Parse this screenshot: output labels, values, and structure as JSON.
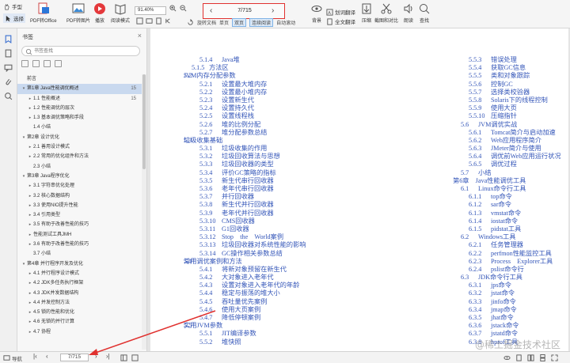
{
  "toolbar": {
    "hand_label": "手型",
    "select_label": "选择",
    "pdf_to_office_label": "PDF转Office",
    "pdf_to_image_label": "PDF转图片",
    "play_label": "播放",
    "read_mode_label": "阅读模式",
    "zoom_value": "91.40%",
    "page_value": "7/715",
    "rotate_label": "旋转文档",
    "single_page_label": "单页",
    "double_page_label": "双页",
    "continuous_read_label": "连续阅读",
    "auto_scroll_label": "自动滚动",
    "background_label": "背景",
    "translate_label": "划词翻译",
    "full_translate_label": "全文翻译",
    "compress_label": "压缩",
    "crop_label": "截图和对比",
    "read_aloud_label": "朗读",
    "find_label": "查找"
  },
  "sidebar": {
    "title": "书签",
    "search_placeholder": "书签查找",
    "items": [
      {
        "text": "前言",
        "toggle": "",
        "indent": 0,
        "page": "",
        "selected": false
      },
      {
        "text": "第1章 Java性能调优概述",
        "toggle": "▾",
        "indent": 0,
        "page": "15",
        "selected": true
      },
      {
        "text": "1.1 性能概述",
        "toggle": "▸",
        "indent": 1,
        "page": "15",
        "selected": false
      },
      {
        "text": "1.2 性能调优的层次",
        "toggle": "▸",
        "indent": 1,
        "page": "",
        "selected": false
      },
      {
        "text": "1.3 基本调优策略和手段",
        "toggle": "▸",
        "indent": 1,
        "page": "",
        "selected": false
      },
      {
        "text": "1.4 小结",
        "toggle": "",
        "indent": 1,
        "page": "",
        "selected": false
      },
      {
        "text": "第2章 设计优化",
        "toggle": "▾",
        "indent": 0,
        "page": "",
        "selected": false
      },
      {
        "text": "2.1 善用设计模式",
        "toggle": "▸",
        "indent": 1,
        "page": "",
        "selected": false
      },
      {
        "text": "2.2 常用的优化组件和方法",
        "toggle": "▸",
        "indent": 1,
        "page": "",
        "selected": false
      },
      {
        "text": "2.3 小结",
        "toggle": "",
        "indent": 1,
        "page": "",
        "selected": false
      },
      {
        "text": "第3章 Java程序优化",
        "toggle": "▾",
        "indent": 0,
        "page": "",
        "selected": false
      },
      {
        "text": "3.1 字符串优化处理",
        "toggle": "▸",
        "indent": 1,
        "page": "",
        "selected": false
      },
      {
        "text": "3.2 核心数据结构",
        "toggle": "▸",
        "indent": 1,
        "page": "",
        "selected": false
      },
      {
        "text": "3.3 使用NIO提升性能",
        "toggle": "▸",
        "indent": 1,
        "page": "",
        "selected": false
      },
      {
        "text": "3.4 引用类型",
        "toggle": "▸",
        "indent": 1,
        "page": "",
        "selected": false
      },
      {
        "text": "3.5 有助于改善性能的技巧",
        "toggle": "▸",
        "indent": 1,
        "page": "",
        "selected": false
      },
      {
        "text": "性能测试工具JMH",
        "toggle": "▸",
        "indent": 1,
        "page": "",
        "selected": false
      },
      {
        "text": "3.6 有助于改善性能的技巧",
        "toggle": "▸",
        "indent": 1,
        "page": "",
        "selected": false
      },
      {
        "text": "3.7 小结",
        "toggle": "",
        "indent": 1,
        "page": "",
        "selected": false
      },
      {
        "text": "第4章 并行程序开发及优化",
        "toggle": "▾",
        "indent": 0,
        "page": "",
        "selected": false
      },
      {
        "text": "4.1 并行程序设计模式",
        "toggle": "▸",
        "indent": 1,
        "page": "",
        "selected": false
      },
      {
        "text": "4.2 JDK多任务执行框架",
        "toggle": "▸",
        "indent": 1,
        "page": "",
        "selected": false
      },
      {
        "text": "4.3 JDK并发数据结构",
        "toggle": "▸",
        "indent": 1,
        "page": "",
        "selected": false
      },
      {
        "text": "4.4 并发控制方法",
        "toggle": "▸",
        "indent": 1,
        "page": "",
        "selected": false
      },
      {
        "text": "4.5 锁的性能和优化",
        "toggle": "▸",
        "indent": 1,
        "page": "",
        "selected": false
      },
      {
        "text": "4.6 无锁的并行计算",
        "toggle": "▸",
        "indent": 1,
        "page": "",
        "selected": false
      },
      {
        "text": "4.7 协程",
        "toggle": "▸",
        "indent": 1,
        "page": "",
        "selected": false
      }
    ]
  },
  "toc": {
    "left": [
      {
        "num": "5.1.4",
        "text": "Java堆",
        "level": 3
      },
      {
        "num": "5.1.5",
        "text": "方法区",
        "level": 2
      },
      {
        "num": "5.2",
        "text": "JVM内存分配参数",
        "level": 1
      },
      {
        "num": "5.2.1",
        "text": "设置最大堆内存",
        "level": 3
      },
      {
        "num": "5.2.2",
        "text": "设置最小堆内存",
        "level": 3
      },
      {
        "num": "5.2.3",
        "text": "设置新生代",
        "level": 3
      },
      {
        "num": "5.2.4",
        "text": "设置持久代",
        "level": 3
      },
      {
        "num": "5.2.5",
        "text": "设置线程栈",
        "level": 3
      },
      {
        "num": "5.2.6",
        "text": "堆的比例分配",
        "level": 3
      },
      {
        "num": "5.2.7",
        "text": "堆分配参数总结",
        "level": 3
      },
      {
        "num": "5.3",
        "text": "垃圾收集基础",
        "level": 1
      },
      {
        "num": "5.3.1",
        "text": "垃圾收集的作用",
        "level": 3
      },
      {
        "num": "5.3.2",
        "text": "垃圾回收算法与思想",
        "level": 3
      },
      {
        "num": "5.3.3",
        "text": "垃圾回收器的类型",
        "level": 3
      },
      {
        "num": "5.3.4",
        "text": "评价GC策略的指标",
        "level": 3
      },
      {
        "num": "5.3.5",
        "text": "新生代串行回收器",
        "level": 3
      },
      {
        "num": "5.3.6",
        "text": "老年代串行回收器",
        "level": 3
      },
      {
        "num": "5.3.7",
        "text": "并行回收器",
        "level": 3
      },
      {
        "num": "5.3.8",
        "text": "新生代并行回收器",
        "level": 3
      },
      {
        "num": "5.3.9",
        "text": "老年代并行回收器",
        "level": 3
      },
      {
        "num": "5.3.10",
        "text": "CMS回收器",
        "level": 3
      },
      {
        "num": "5.3.11",
        "text": "G1回收器",
        "level": 3
      },
      {
        "num": "5.3.12",
        "text": "Stop　the　World案例",
        "level": 3
      },
      {
        "num": "5.3.13",
        "text": "垃圾回收器对系统性能的影响",
        "level": 3
      },
      {
        "num": "5.3.14",
        "text": "GC操作相关参数总结",
        "level": 3
      },
      {
        "num": "5.4",
        "text": "常用调优案例和方法",
        "level": 1
      },
      {
        "num": "5.4.1",
        "text": "将新对象预留在新生代",
        "level": 3
      },
      {
        "num": "5.4.2",
        "text": "大对象进入老年代",
        "level": 3
      },
      {
        "num": "5.4.3",
        "text": "设置对象进入老年代的年龄",
        "level": 3
      },
      {
        "num": "5.4.4",
        "text": "稳定与振荡的堆大小",
        "level": 3
      },
      {
        "num": "5.4.5",
        "text": "吞吐量优先案例",
        "level": 3
      },
      {
        "num": "5.4.6",
        "text": "使用大页案例",
        "level": 3
      },
      {
        "num": "5.4.7",
        "text": "降低停顿案例",
        "level": 3
      },
      {
        "num": "5.5",
        "text": "实用JVM参数",
        "level": 1
      },
      {
        "num": "5.5.1",
        "text": "JIT编译参数",
        "level": 3
      },
      {
        "num": "5.5.2",
        "text": "堆快照",
        "level": 3
      }
    ],
    "right": [
      {
        "num": "5.5.3",
        "text": "错误处理",
        "level": 3
      },
      {
        "num": "5.5.4",
        "text": "获取GC信息",
        "level": 3
      },
      {
        "num": "5.5.5",
        "text": "类和对象跟踪",
        "level": 3
      },
      {
        "num": "5.5.6",
        "text": "控制GC",
        "level": 3
      },
      {
        "num": "5.5.7",
        "text": "选择类校验器",
        "level": 3
      },
      {
        "num": "5.5.8",
        "text": "Solaris下的线程控制",
        "level": 3
      },
      {
        "num": "5.5.9",
        "text": "使用大页",
        "level": 3
      },
      {
        "num": "5.5.10",
        "text": "压缩指针",
        "level": 3
      },
      {
        "num": "5.6",
        "text": "JVM调优实战",
        "level": 2
      },
      {
        "num": "5.6.1",
        "text": "Tomcat简介与启动加速",
        "level": 3
      },
      {
        "num": "5.6.2",
        "text": "Web应用程序简介",
        "level": 3
      },
      {
        "num": "5.6.3",
        "text": "JMeter简介与使用",
        "level": 3
      },
      {
        "num": "5.6.4",
        "text": "调优前Web应用运行状况",
        "level": 3
      },
      {
        "num": "5.6.5",
        "text": "调优过程",
        "level": 3
      },
      {
        "num": "5.7",
        "text": "小结",
        "level": 2
      },
      {
        "num": "",
        "text": "第6章　Java性能调优工具",
        "level": 1
      },
      {
        "num": "6.1",
        "text": "Linux命令行工具",
        "level": 2
      },
      {
        "num": "6.1.1",
        "text": "top命令",
        "level": 3
      },
      {
        "num": "6.1.2",
        "text": "sar命令",
        "level": 3
      },
      {
        "num": "6.1.3",
        "text": "vmstat命令",
        "level": 3
      },
      {
        "num": "6.1.4",
        "text": "iostat命令",
        "level": 3
      },
      {
        "num": "6.1.5",
        "text": "pidstat工具",
        "level": 3
      },
      {
        "num": "6.2",
        "text": "Windows工具",
        "level": 2
      },
      {
        "num": "6.2.1",
        "text": "任务管理器",
        "level": 3
      },
      {
        "num": "6.2.2",
        "text": "perfmon性能监控工具",
        "level": 3
      },
      {
        "num": "6.2.3",
        "text": "Process　Explorer工具",
        "level": 3
      },
      {
        "num": "6.2.4",
        "text": "pslist命令行",
        "level": 3
      },
      {
        "num": "6.3",
        "text": "JDK命令行工具",
        "level": 2
      },
      {
        "num": "6.3.1",
        "text": "jps命令",
        "level": 3
      },
      {
        "num": "6.3.2",
        "text": "jstat命令",
        "level": 3
      },
      {
        "num": "6.3.3",
        "text": "jinfo命令",
        "level": 3
      },
      {
        "num": "6.3.4",
        "text": "jmap命令",
        "level": 3
      },
      {
        "num": "6.3.5",
        "text": "jhat命令",
        "level": 3
      },
      {
        "num": "6.3.6",
        "text": "jstack命令",
        "level": 3
      },
      {
        "num": "6.3.7",
        "text": "jstatd命令",
        "level": 3
      },
      {
        "num": "6.3.8",
        "text": "hprof工具",
        "level": 3
      }
    ]
  },
  "statusbar": {
    "nav_label": "导航",
    "page_value": "7/715"
  },
  "watermark": "@稀土掘金技术社区",
  "colors": {
    "toc_link": "#3355b8",
    "highlight_red": "#e0312f",
    "selected_bookmark": "#c9d9ef"
  }
}
